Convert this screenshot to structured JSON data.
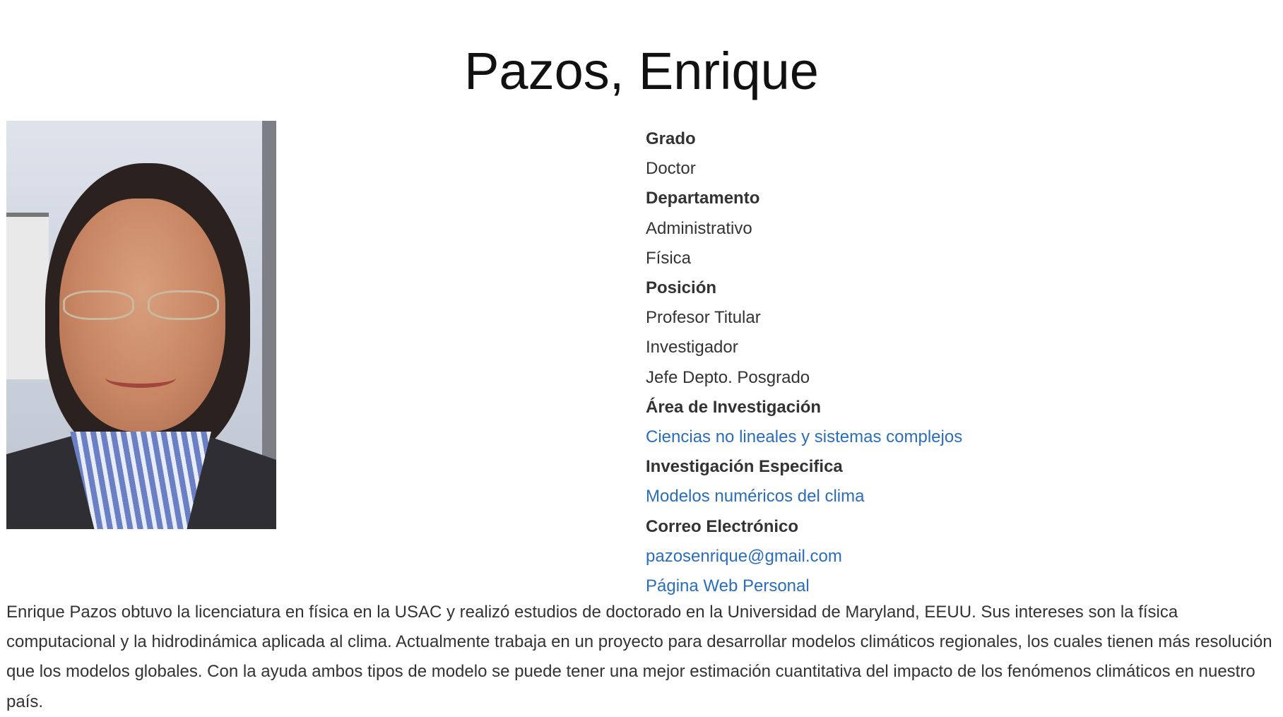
{
  "title": "Pazos, Enrique",
  "photo_alt": "Enrique Pazos",
  "fields": {
    "grado_label": "Grado",
    "grado": [
      "Doctor"
    ],
    "departamento_label": "Departamento",
    "departamento": [
      "Administrativo",
      "Física"
    ],
    "posicion_label": "Posición",
    "posicion": [
      "Profesor Titular",
      "Investigador",
      "Jefe Depto. Posgrado"
    ],
    "area_label": "Área de Investigación",
    "area_link": "Ciencias no lineales y sistemas complejos",
    "especifica_label": "Investigación Especifica",
    "especifica_link": "Modelos numéricos del clima",
    "correo_label": "Correo Electrónico",
    "correo_link": "pazosenrique@gmail.com",
    "web_link": "Página Web Personal"
  },
  "bio": "Enrique Pazos obtuvo la licenciatura en física en la USAC y realizó estudios de doctorado en la Universidad de Maryland, EEUU. Sus intereses son la física computacional y la hidrodinámica aplicada al clima. Actualmente trabaja en un proyecto para desarrollar modelos climáticos regionales, los cuales tienen más resolución que los modelos globales. Con la ayuda ambos tipos de modelo se puede tener una mejor estimación cuantitativa del impacto de los fenómenos climáticos en nuestro país.",
  "colors": {
    "link": "#2a6ebb",
    "text": "#333333"
  }
}
